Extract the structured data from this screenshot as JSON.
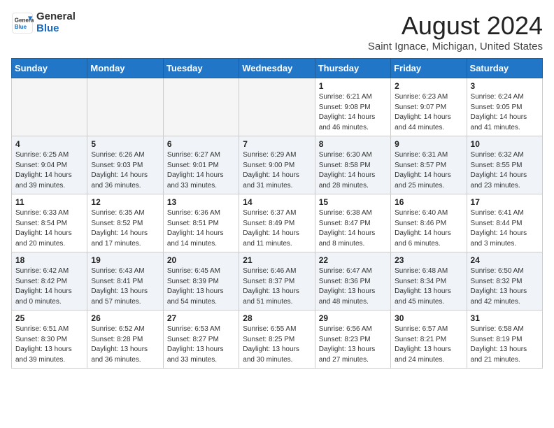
{
  "header": {
    "logo_general": "General",
    "logo_blue": "Blue",
    "month_title": "August 2024",
    "location": "Saint Ignace, Michigan, United States"
  },
  "weekdays": [
    "Sunday",
    "Monday",
    "Tuesday",
    "Wednesday",
    "Thursday",
    "Friday",
    "Saturday"
  ],
  "weeks": [
    [
      {
        "day": "",
        "info": ""
      },
      {
        "day": "",
        "info": ""
      },
      {
        "day": "",
        "info": ""
      },
      {
        "day": "",
        "info": ""
      },
      {
        "day": "1",
        "info": "Sunrise: 6:21 AM\nSunset: 9:08 PM\nDaylight: 14 hours and 46 minutes."
      },
      {
        "day": "2",
        "info": "Sunrise: 6:23 AM\nSunset: 9:07 PM\nDaylight: 14 hours and 44 minutes."
      },
      {
        "day": "3",
        "info": "Sunrise: 6:24 AM\nSunset: 9:05 PM\nDaylight: 14 hours and 41 minutes."
      }
    ],
    [
      {
        "day": "4",
        "info": "Sunrise: 6:25 AM\nSunset: 9:04 PM\nDaylight: 14 hours and 39 minutes."
      },
      {
        "day": "5",
        "info": "Sunrise: 6:26 AM\nSunset: 9:03 PM\nDaylight: 14 hours and 36 minutes."
      },
      {
        "day": "6",
        "info": "Sunrise: 6:27 AM\nSunset: 9:01 PM\nDaylight: 14 hours and 33 minutes."
      },
      {
        "day": "7",
        "info": "Sunrise: 6:29 AM\nSunset: 9:00 PM\nDaylight: 14 hours and 31 minutes."
      },
      {
        "day": "8",
        "info": "Sunrise: 6:30 AM\nSunset: 8:58 PM\nDaylight: 14 hours and 28 minutes."
      },
      {
        "day": "9",
        "info": "Sunrise: 6:31 AM\nSunset: 8:57 PM\nDaylight: 14 hours and 25 minutes."
      },
      {
        "day": "10",
        "info": "Sunrise: 6:32 AM\nSunset: 8:55 PM\nDaylight: 14 hours and 23 minutes."
      }
    ],
    [
      {
        "day": "11",
        "info": "Sunrise: 6:33 AM\nSunset: 8:54 PM\nDaylight: 14 hours and 20 minutes."
      },
      {
        "day": "12",
        "info": "Sunrise: 6:35 AM\nSunset: 8:52 PM\nDaylight: 14 hours and 17 minutes."
      },
      {
        "day": "13",
        "info": "Sunrise: 6:36 AM\nSunset: 8:51 PM\nDaylight: 14 hours and 14 minutes."
      },
      {
        "day": "14",
        "info": "Sunrise: 6:37 AM\nSunset: 8:49 PM\nDaylight: 14 hours and 11 minutes."
      },
      {
        "day": "15",
        "info": "Sunrise: 6:38 AM\nSunset: 8:47 PM\nDaylight: 14 hours and 8 minutes."
      },
      {
        "day": "16",
        "info": "Sunrise: 6:40 AM\nSunset: 8:46 PM\nDaylight: 14 hours and 6 minutes."
      },
      {
        "day": "17",
        "info": "Sunrise: 6:41 AM\nSunset: 8:44 PM\nDaylight: 14 hours and 3 minutes."
      }
    ],
    [
      {
        "day": "18",
        "info": "Sunrise: 6:42 AM\nSunset: 8:42 PM\nDaylight: 14 hours and 0 minutes."
      },
      {
        "day": "19",
        "info": "Sunrise: 6:43 AM\nSunset: 8:41 PM\nDaylight: 13 hours and 57 minutes."
      },
      {
        "day": "20",
        "info": "Sunrise: 6:45 AM\nSunset: 8:39 PM\nDaylight: 13 hours and 54 minutes."
      },
      {
        "day": "21",
        "info": "Sunrise: 6:46 AM\nSunset: 8:37 PM\nDaylight: 13 hours and 51 minutes."
      },
      {
        "day": "22",
        "info": "Sunrise: 6:47 AM\nSunset: 8:36 PM\nDaylight: 13 hours and 48 minutes."
      },
      {
        "day": "23",
        "info": "Sunrise: 6:48 AM\nSunset: 8:34 PM\nDaylight: 13 hours and 45 minutes."
      },
      {
        "day": "24",
        "info": "Sunrise: 6:50 AM\nSunset: 8:32 PM\nDaylight: 13 hours and 42 minutes."
      }
    ],
    [
      {
        "day": "25",
        "info": "Sunrise: 6:51 AM\nSunset: 8:30 PM\nDaylight: 13 hours and 39 minutes."
      },
      {
        "day": "26",
        "info": "Sunrise: 6:52 AM\nSunset: 8:28 PM\nDaylight: 13 hours and 36 minutes."
      },
      {
        "day": "27",
        "info": "Sunrise: 6:53 AM\nSunset: 8:27 PM\nDaylight: 13 hours and 33 minutes."
      },
      {
        "day": "28",
        "info": "Sunrise: 6:55 AM\nSunset: 8:25 PM\nDaylight: 13 hours and 30 minutes."
      },
      {
        "day": "29",
        "info": "Sunrise: 6:56 AM\nSunset: 8:23 PM\nDaylight: 13 hours and 27 minutes."
      },
      {
        "day": "30",
        "info": "Sunrise: 6:57 AM\nSunset: 8:21 PM\nDaylight: 13 hours and 24 minutes."
      },
      {
        "day": "31",
        "info": "Sunrise: 6:58 AM\nSunset: 8:19 PM\nDaylight: 13 hours and 21 minutes."
      }
    ]
  ]
}
